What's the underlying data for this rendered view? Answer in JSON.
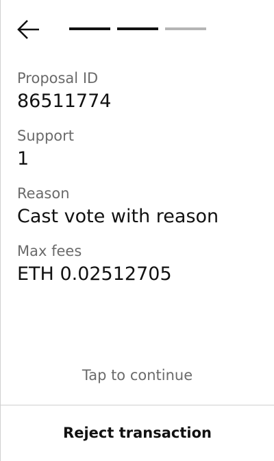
{
  "header": {
    "back_icon": "arrow-left-icon",
    "steps": {
      "total": 3,
      "completed": 2,
      "active_color": "#111111",
      "inactive_color": "#b5b5b5"
    }
  },
  "fields": [
    {
      "label": "Proposal ID",
      "value": "86511774"
    },
    {
      "label": "Support",
      "value": "1"
    },
    {
      "label": "Reason",
      "value": "Cast vote with reason"
    },
    {
      "label": "Max fees",
      "value": "ETH 0.02512705"
    }
  ],
  "tap_hint": "Tap to continue",
  "reject_button": "Reject transaction"
}
